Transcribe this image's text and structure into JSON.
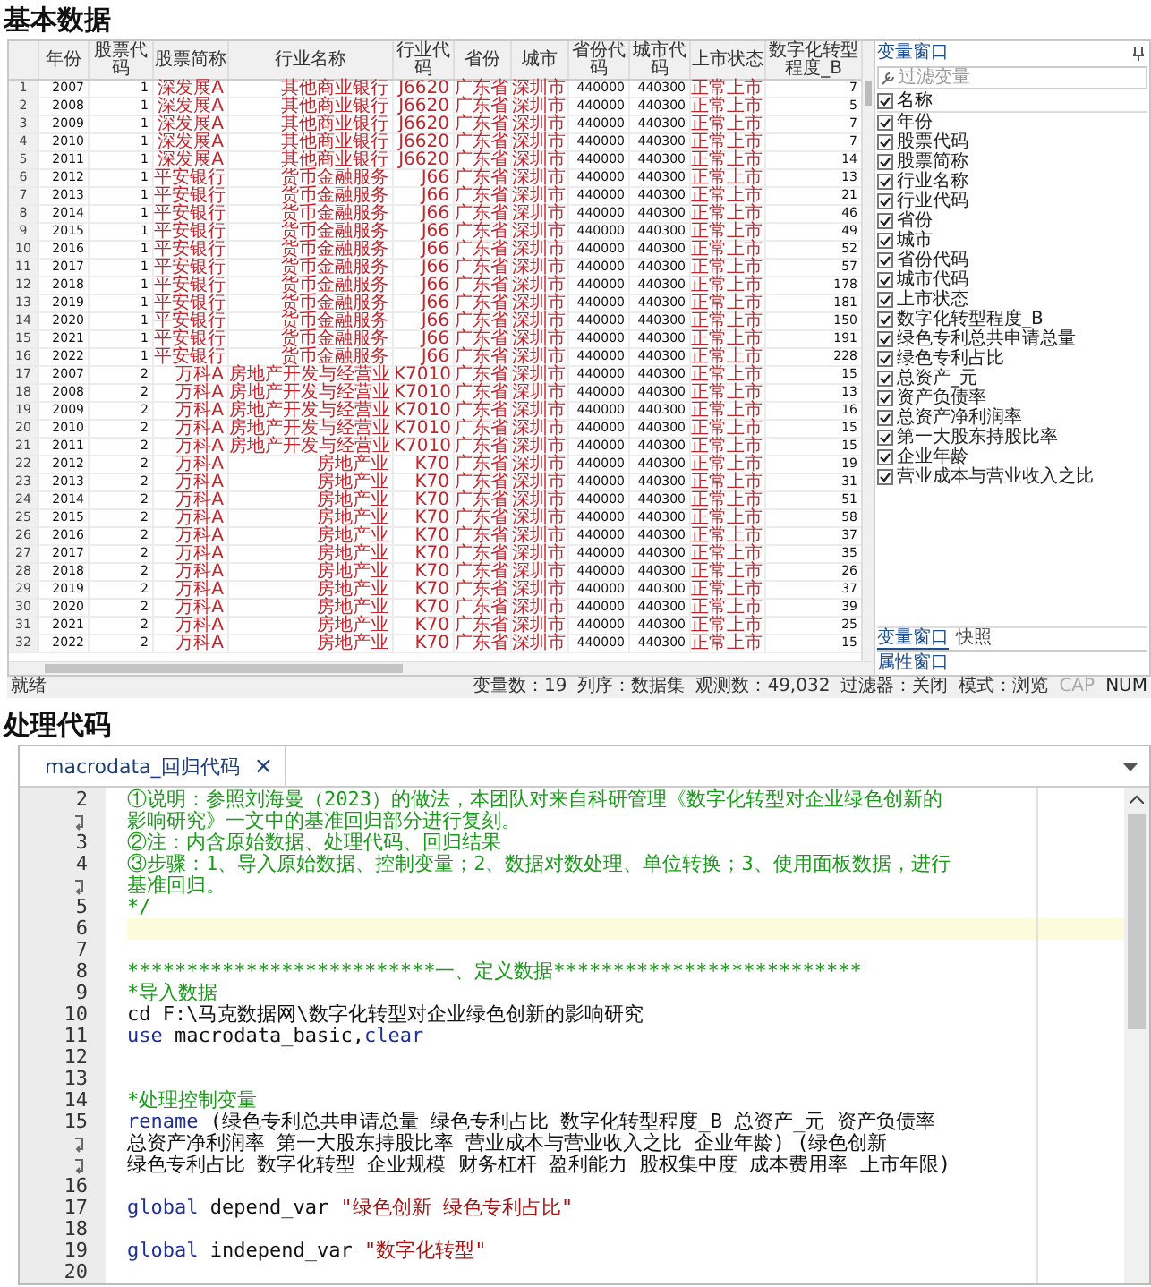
{
  "sections": [
    {
      "heading": "基本数据"
    },
    {
      "heading": "处理代码"
    }
  ],
  "data_editor": {
    "columns": [
      {
        "label": "年份",
        "kind": "number"
      },
      {
        "label": "股票代码",
        "kind": "number"
      },
      {
        "label": "股票简称",
        "kind": "string"
      },
      {
        "label": "行业名称",
        "kind": "string"
      },
      {
        "label": "行业代码",
        "kind": "string"
      },
      {
        "label": "省份",
        "kind": "string"
      },
      {
        "label": "城市",
        "kind": "string"
      },
      {
        "label": "省份代码",
        "kind": "number"
      },
      {
        "label": "城市代码",
        "kind": "number"
      },
      {
        "label": "上市状态",
        "kind": "string"
      },
      {
        "label": "数字化转型程度_B",
        "kind": "number"
      }
    ],
    "rows": [
      {
        "n": "1",
        "cells": [
          "2007",
          "1",
          "深发展A",
          "其他商业银行",
          "J6620",
          "广东省",
          "深圳市",
          "440000",
          "440300",
          "正常上市",
          "7"
        ]
      },
      {
        "n": "2",
        "cells": [
          "2008",
          "1",
          "深发展A",
          "其他商业银行",
          "J6620",
          "广东省",
          "深圳市",
          "440000",
          "440300",
          "正常上市",
          "5"
        ]
      },
      {
        "n": "3",
        "cells": [
          "2009",
          "1",
          "深发展A",
          "其他商业银行",
          "J6620",
          "广东省",
          "深圳市",
          "440000",
          "440300",
          "正常上市",
          "7"
        ]
      },
      {
        "n": "4",
        "cells": [
          "2010",
          "1",
          "深发展A",
          "其他商业银行",
          "J6620",
          "广东省",
          "深圳市",
          "440000",
          "440300",
          "正常上市",
          "7"
        ]
      },
      {
        "n": "5",
        "cells": [
          "2011",
          "1",
          "深发展A",
          "其他商业银行",
          "J6620",
          "广东省",
          "深圳市",
          "440000",
          "440300",
          "正常上市",
          "14"
        ]
      },
      {
        "n": "6",
        "cells": [
          "2012",
          "1",
          "平安银行",
          "货币金融服务",
          "J66",
          "广东省",
          "深圳市",
          "440000",
          "440300",
          "正常上市",
          "13"
        ]
      },
      {
        "n": "7",
        "cells": [
          "2013",
          "1",
          "平安银行",
          "货币金融服务",
          "J66",
          "广东省",
          "深圳市",
          "440000",
          "440300",
          "正常上市",
          "21"
        ]
      },
      {
        "n": "8",
        "cells": [
          "2014",
          "1",
          "平安银行",
          "货币金融服务",
          "J66",
          "广东省",
          "深圳市",
          "440000",
          "440300",
          "正常上市",
          "46"
        ]
      },
      {
        "n": "9",
        "cells": [
          "2015",
          "1",
          "平安银行",
          "货币金融服务",
          "J66",
          "广东省",
          "深圳市",
          "440000",
          "440300",
          "正常上市",
          "49"
        ]
      },
      {
        "n": "10",
        "cells": [
          "2016",
          "1",
          "平安银行",
          "货币金融服务",
          "J66",
          "广东省",
          "深圳市",
          "440000",
          "440300",
          "正常上市",
          "52"
        ]
      },
      {
        "n": "11",
        "cells": [
          "2017",
          "1",
          "平安银行",
          "货币金融服务",
          "J66",
          "广东省",
          "深圳市",
          "440000",
          "440300",
          "正常上市",
          "57"
        ]
      },
      {
        "n": "12",
        "cells": [
          "2018",
          "1",
          "平安银行",
          "货币金融服务",
          "J66",
          "广东省",
          "深圳市",
          "440000",
          "440300",
          "正常上市",
          "178"
        ]
      },
      {
        "n": "13",
        "cells": [
          "2019",
          "1",
          "平安银行",
          "货币金融服务",
          "J66",
          "广东省",
          "深圳市",
          "440000",
          "440300",
          "正常上市",
          "181"
        ]
      },
      {
        "n": "14",
        "cells": [
          "2020",
          "1",
          "平安银行",
          "货币金融服务",
          "J66",
          "广东省",
          "深圳市",
          "440000",
          "440300",
          "正常上市",
          "150"
        ]
      },
      {
        "n": "15",
        "cells": [
          "2021",
          "1",
          "平安银行",
          "货币金融服务",
          "J66",
          "广东省",
          "深圳市",
          "440000",
          "440300",
          "正常上市",
          "191"
        ]
      },
      {
        "n": "16",
        "cells": [
          "2022",
          "1",
          "平安银行",
          "货币金融服务",
          "J66",
          "广东省",
          "深圳市",
          "440000",
          "440300",
          "正常上市",
          "228"
        ]
      },
      {
        "n": "17",
        "cells": [
          "2007",
          "2",
          "万科A",
          "房地产开发与经营业",
          "K7010",
          "广东省",
          "深圳市",
          "440000",
          "440300",
          "正常上市",
          "15"
        ]
      },
      {
        "n": "18",
        "cells": [
          "2008",
          "2",
          "万科A",
          "房地产开发与经营业",
          "K7010",
          "广东省",
          "深圳市",
          "440000",
          "440300",
          "正常上市",
          "13"
        ]
      },
      {
        "n": "19",
        "cells": [
          "2009",
          "2",
          "万科A",
          "房地产开发与经营业",
          "K7010",
          "广东省",
          "深圳市",
          "440000",
          "440300",
          "正常上市",
          "16"
        ]
      },
      {
        "n": "20",
        "cells": [
          "2010",
          "2",
          "万科A",
          "房地产开发与经营业",
          "K7010",
          "广东省",
          "深圳市",
          "440000",
          "440300",
          "正常上市",
          "15"
        ]
      },
      {
        "n": "21",
        "cells": [
          "2011",
          "2",
          "万科A",
          "房地产开发与经营业",
          "K7010",
          "广东省",
          "深圳市",
          "440000",
          "440300",
          "正常上市",
          "15"
        ]
      },
      {
        "n": "22",
        "cells": [
          "2012",
          "2",
          "万科A",
          "房地产业",
          "K70",
          "广东省",
          "深圳市",
          "440000",
          "440300",
          "正常上市",
          "19"
        ]
      },
      {
        "n": "23",
        "cells": [
          "2013",
          "2",
          "万科A",
          "房地产业",
          "K70",
          "广东省",
          "深圳市",
          "440000",
          "440300",
          "正常上市",
          "31"
        ]
      },
      {
        "n": "24",
        "cells": [
          "2014",
          "2",
          "万科A",
          "房地产业",
          "K70",
          "广东省",
          "深圳市",
          "440000",
          "440300",
          "正常上市",
          "51"
        ]
      },
      {
        "n": "25",
        "cells": [
          "2015",
          "2",
          "万科A",
          "房地产业",
          "K70",
          "广东省",
          "深圳市",
          "440000",
          "440300",
          "正常上市",
          "58"
        ]
      },
      {
        "n": "26",
        "cells": [
          "2016",
          "2",
          "万科A",
          "房地产业",
          "K70",
          "广东省",
          "深圳市",
          "440000",
          "440300",
          "正常上市",
          "37"
        ]
      },
      {
        "n": "27",
        "cells": [
          "2017",
          "2",
          "万科A",
          "房地产业",
          "K70",
          "广东省",
          "深圳市",
          "440000",
          "440300",
          "正常上市",
          "35"
        ]
      },
      {
        "n": "28",
        "cells": [
          "2018",
          "2",
          "万科A",
          "房地产业",
          "K70",
          "广东省",
          "深圳市",
          "440000",
          "440300",
          "正常上市",
          "26"
        ]
      },
      {
        "n": "29",
        "cells": [
          "2019",
          "2",
          "万科A",
          "房地产业",
          "K70",
          "广东省",
          "深圳市",
          "440000",
          "440300",
          "正常上市",
          "37"
        ]
      },
      {
        "n": "30",
        "cells": [
          "2020",
          "2",
          "万科A",
          "房地产业",
          "K70",
          "广东省",
          "深圳市",
          "440000",
          "440300",
          "正常上市",
          "39"
        ]
      },
      {
        "n": "31",
        "cells": [
          "2021",
          "2",
          "万科A",
          "房地产业",
          "K70",
          "广东省",
          "深圳市",
          "440000",
          "440300",
          "正常上市",
          "25"
        ]
      },
      {
        "n": "32",
        "cells": [
          "2022",
          "2",
          "万科A",
          "房地产业",
          "K70",
          "广东省",
          "深圳市",
          "440000",
          "440300",
          "正常上市",
          "15"
        ]
      }
    ],
    "variables_panel": {
      "title": "变量窗口",
      "filter_placeholder": "过滤变量",
      "name_header": "名称",
      "all_checked": true,
      "variables": [
        {
          "name": "年份",
          "checked": true
        },
        {
          "name": "股票代码",
          "checked": true
        },
        {
          "name": "股票简称",
          "checked": true
        },
        {
          "name": "行业名称",
          "checked": true
        },
        {
          "name": "行业代码",
          "checked": true
        },
        {
          "name": "省份",
          "checked": true
        },
        {
          "name": "城市",
          "checked": true
        },
        {
          "name": "省份代码",
          "checked": true
        },
        {
          "name": "城市代码",
          "checked": true
        },
        {
          "name": "上市状态",
          "checked": true
        },
        {
          "name": "数字化转型程度_B",
          "checked": true
        },
        {
          "name": "绿色专利总共申请总量",
          "checked": true
        },
        {
          "name": "绿色专利占比",
          "checked": true
        },
        {
          "name": "总资产_元",
          "checked": true
        },
        {
          "name": "资产负债率",
          "checked": true
        },
        {
          "name": "总资产净利润率",
          "checked": true
        },
        {
          "name": "第一大股东持股比率",
          "checked": true
        },
        {
          "name": "企业年龄",
          "checked": true
        },
        {
          "name": "营业成本与营业收入之比",
          "checked": true
        }
      ],
      "tabs": [
        {
          "label": "变量窗口",
          "selected": true
        },
        {
          "label": "快照",
          "selected": false
        }
      ],
      "properties_title": "属性窗口"
    },
    "status_bar": {
      "left": "就绪",
      "items": [
        "变量数：19",
        "列序：数据集",
        "观测数：49,032",
        "过滤器：关闭",
        "模式：浏览"
      ],
      "indicators": [
        {
          "label": "CAP",
          "on": false
        },
        {
          "label": "NUM",
          "on": true
        }
      ]
    }
  },
  "code_editor": {
    "tab": {
      "title": "macrodata_回归代码",
      "close": "×"
    },
    "lines": [
      {
        "number": "2",
        "wrapped": false,
        "current": false,
        "tokens": [
          {
            "kind": "comment",
            "text": "①说明：参照刘海曼（2023）的做法，本团队对来自科研管理《数字化转型对企业绿色创新的"
          }
        ]
      },
      {
        "wrapped": true,
        "current": false,
        "tokens": [
          {
            "kind": "comment",
            "text": "影响研究》一文中的基准回归部分进行复刻。"
          }
        ]
      },
      {
        "number": "3",
        "wrapped": false,
        "current": false,
        "tokens": [
          {
            "kind": "comment",
            "text": "②注：内含原始数据、处理代码、回归结果"
          }
        ]
      },
      {
        "number": "4",
        "wrapped": false,
        "current": false,
        "tokens": [
          {
            "kind": "comment",
            "text": "③步骤：1、导入原始数据、控制变量；2、数据对数处理、单位转换；3、使用面板数据，进行"
          }
        ]
      },
      {
        "wrapped": true,
        "current": false,
        "tokens": [
          {
            "kind": "comment",
            "text": "基准回归。"
          }
        ]
      },
      {
        "number": "5",
        "wrapped": false,
        "current": false,
        "tokens": [
          {
            "kind": "comment",
            "text": "*/"
          }
        ]
      },
      {
        "number": "6",
        "wrapped": false,
        "current": true
      },
      {
        "number": "7",
        "wrapped": false,
        "current": false
      },
      {
        "number": "8",
        "wrapped": false,
        "current": false,
        "tokens": [
          {
            "kind": "comment",
            "text": "**************************一、定义数据**************************"
          }
        ]
      },
      {
        "number": "9",
        "wrapped": false,
        "current": false,
        "tokens": [
          {
            "kind": "comment",
            "text": "*导入数据"
          }
        ]
      },
      {
        "number": "10",
        "wrapped": false,
        "current": false,
        "tokens": [
          {
            "kind": "plain",
            "text": "cd F:\\马克数据网\\数字化转型对企业绿色创新的影响研究"
          }
        ]
      },
      {
        "number": "11",
        "wrapped": false,
        "current": false,
        "tokens": [
          {
            "kind": "keyword",
            "text": "use"
          },
          {
            "kind": "plain",
            "text": " macrodata_basic,"
          },
          {
            "kind": "keyword",
            "text": "clear"
          }
        ]
      },
      {
        "number": "12",
        "wrapped": false,
        "current": false
      },
      {
        "number": "13",
        "wrapped": false,
        "current": false
      },
      {
        "number": "14",
        "wrapped": false,
        "current": false,
        "tokens": [
          {
            "kind": "comment",
            "text": "*处理控制变量"
          }
        ]
      },
      {
        "number": "15",
        "wrapped": false,
        "current": false,
        "tokens": [
          {
            "kind": "keyword",
            "text": "rename"
          },
          {
            "kind": "plain",
            "text": " (绿色专利总共申请总量 绿色专利占比 数字化转型程度_B 总资产_元 资产负债率"
          }
        ]
      },
      {
        "wrapped": true,
        "current": false,
        "tokens": [
          {
            "kind": "plain",
            "text": "总资产净利润率 第一大股东持股比率 营业成本与营业收入之比 企业年龄) (绿色创新"
          }
        ]
      },
      {
        "wrapped": true,
        "current": false,
        "tokens": [
          {
            "kind": "plain",
            "text": "绿色专利占比 数字化转型 企业规模 财务杠杆 盈利能力 股权集中度 成本费用率 上市年限)"
          }
        ]
      },
      {
        "number": "16",
        "wrapped": false,
        "current": false
      },
      {
        "number": "17",
        "wrapped": false,
        "current": false,
        "tokens": [
          {
            "kind": "keyword",
            "text": "global"
          },
          {
            "kind": "plain",
            "text": " depend_var "
          },
          {
            "kind": "string",
            "text": "\"绿色创新 绿色专利占比\""
          }
        ]
      },
      {
        "number": "18",
        "wrapped": false,
        "current": false
      },
      {
        "number": "19",
        "wrapped": false,
        "current": false,
        "tokens": [
          {
            "kind": "keyword",
            "text": "global"
          },
          {
            "kind": "plain",
            "text": " independ_var "
          },
          {
            "kind": "string",
            "text": "\"数字化转型\""
          }
        ]
      },
      {
        "number": "20",
        "wrapped": false,
        "current": false
      }
    ]
  }
}
